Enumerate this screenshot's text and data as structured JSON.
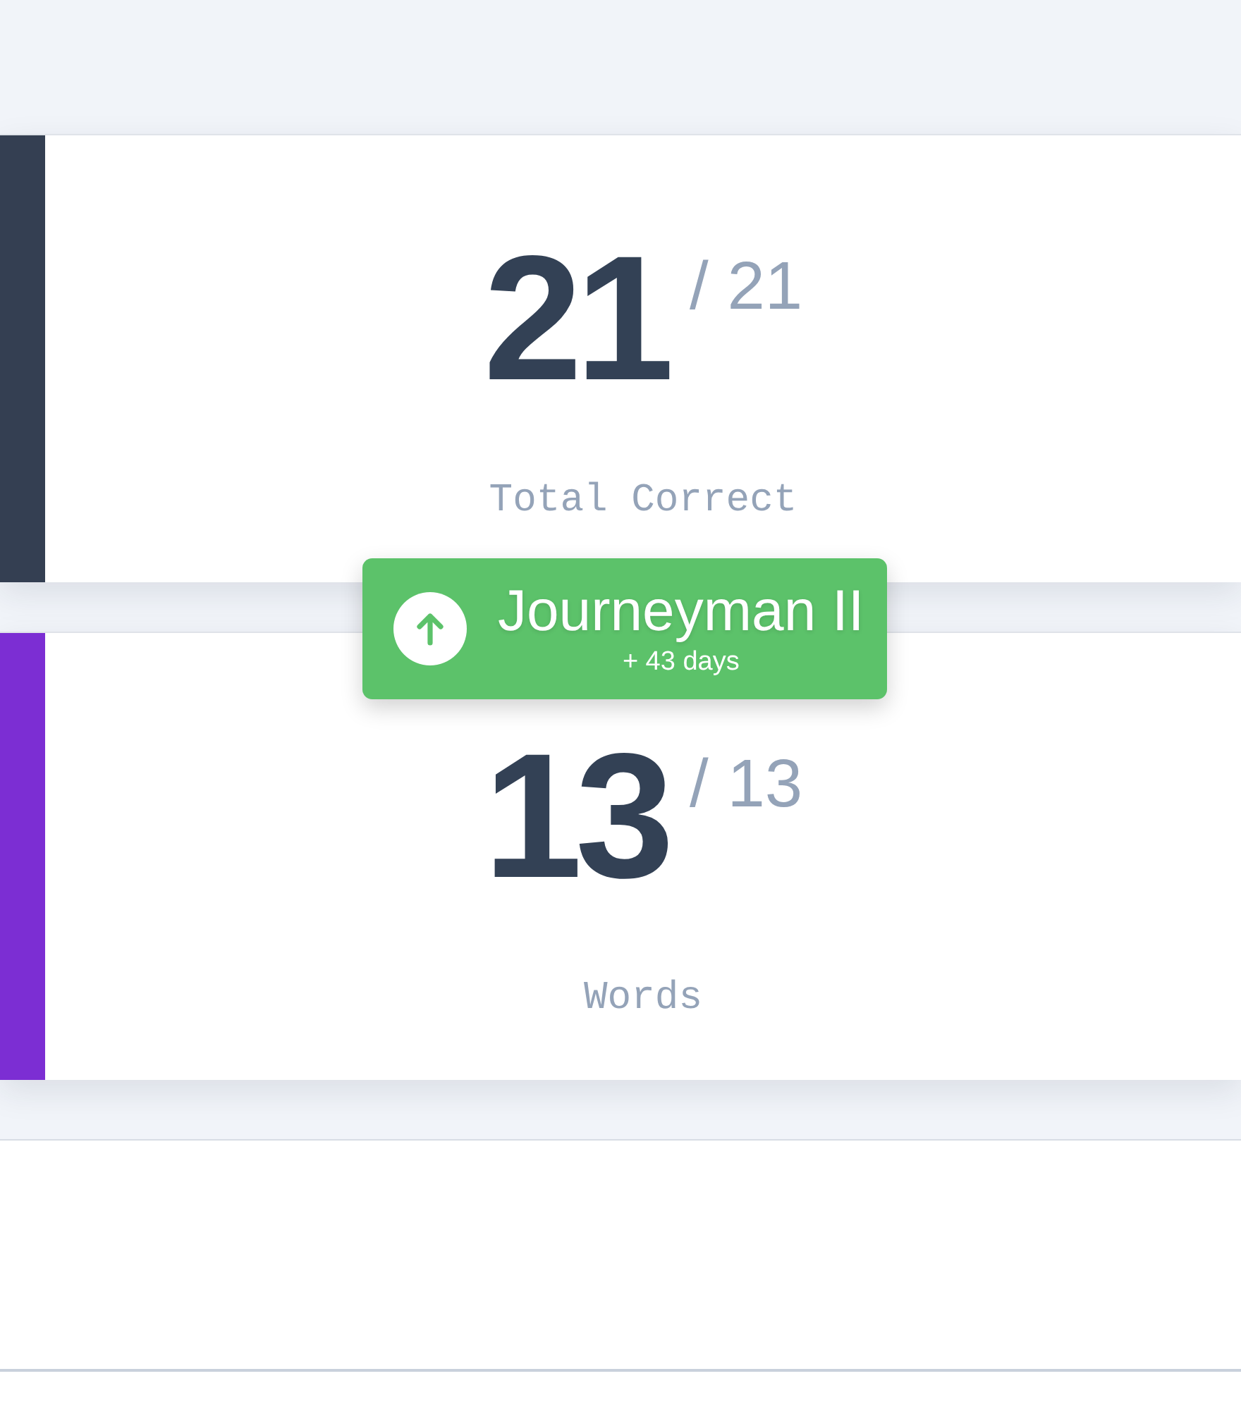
{
  "stats": [
    {
      "value": "21",
      "total": "/ 21",
      "label": "Total Correct",
      "color": "#343f52"
    },
    {
      "value": "13",
      "total": "/ 13",
      "label": "Words",
      "color": "#7c2ed3"
    }
  ],
  "badge": {
    "title": "Journeyman II",
    "subtitle": "+ 43 days"
  }
}
